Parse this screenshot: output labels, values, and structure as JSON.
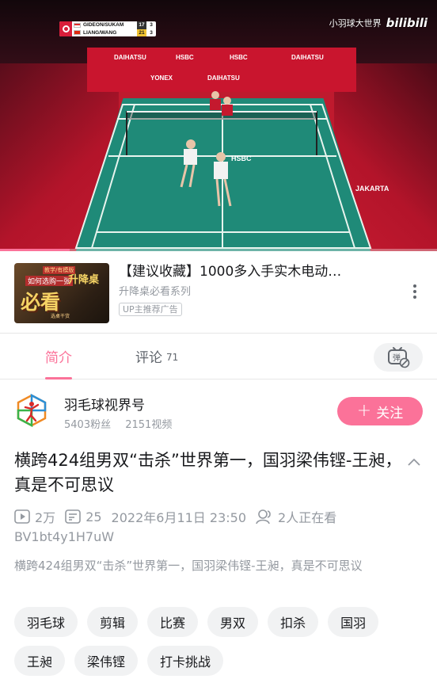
{
  "video": {
    "scoreboard": {
      "team_a": "GIDEON/SUKAM",
      "team_a_game1": "17",
      "team_a_game2": "3",
      "team_b": "LIANG/WANG",
      "team_b_game1": "21",
      "team_b_game2": "3"
    },
    "watermark": {
      "channel": "小羽球大世界",
      "brand": "bilibili"
    },
    "board_texts": [
      "DAIHATSU",
      "HSBC",
      "HSBC",
      "DAIHATSU",
      "YONEX",
      "DAIHATSU",
      "JAKARTA",
      "HSBC"
    ],
    "progress_fraction": 0.16,
    "colors": {
      "progress": "#fb7299"
    }
  },
  "ad": {
    "thumb_texts": {
      "t1": "教学/有模版",
      "t2": "如何选购一张",
      "t3": "升降桌",
      "t4": "必看",
      "t5": "选桌干货"
    },
    "title": "【建议收藏】1000多入手实木电动…",
    "subtitle": "升降桌必看系列",
    "tag": "UP主推荐广告"
  },
  "tabs": {
    "intro": "简介",
    "comments": "评论",
    "comments_count": "71"
  },
  "uploader": {
    "name": "羽毛球视界号",
    "fans": "5403粉丝",
    "videos": "2151视频",
    "follow_label": "关注"
  },
  "video_info": {
    "title": "横跨424组男双“击杀”世界第一，国羽梁伟铿-王昶，真是不可思议",
    "plays": "2万",
    "danmaku": "25",
    "date": "2022年6月11日 23:50",
    "watching": "2人正在看",
    "bvid": "BV1bt4y1H7uW",
    "description": "横跨424组男双“击杀”世界第一，国羽梁伟铿-王昶，真是不可思议"
  },
  "tags": [
    "羽毛球",
    "剪辑",
    "比赛",
    "男双",
    "扣杀",
    "国羽",
    "王昶",
    "梁伟铿",
    "打卡挑战"
  ],
  "theme": {
    "accent": "#fb7299",
    "muted": "#9499a0",
    "text": "#18191c"
  }
}
